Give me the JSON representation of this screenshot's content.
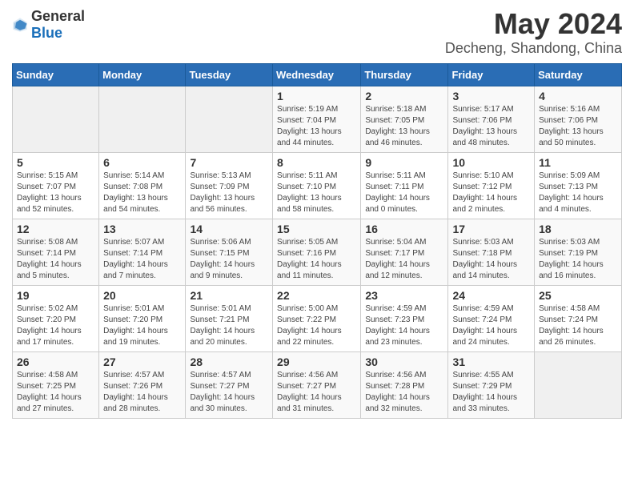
{
  "logo": {
    "general": "General",
    "blue": "Blue"
  },
  "title": "May 2024",
  "location": "Decheng, Shandong, China",
  "weekdays": [
    "Sunday",
    "Monday",
    "Tuesday",
    "Wednesday",
    "Thursday",
    "Friday",
    "Saturday"
  ],
  "weeks": [
    [
      {
        "day": "",
        "info": ""
      },
      {
        "day": "",
        "info": ""
      },
      {
        "day": "",
        "info": ""
      },
      {
        "day": "1",
        "info": "Sunrise: 5:19 AM\nSunset: 7:04 PM\nDaylight: 13 hours\nand 44 minutes."
      },
      {
        "day": "2",
        "info": "Sunrise: 5:18 AM\nSunset: 7:05 PM\nDaylight: 13 hours\nand 46 minutes."
      },
      {
        "day": "3",
        "info": "Sunrise: 5:17 AM\nSunset: 7:06 PM\nDaylight: 13 hours\nand 48 minutes."
      },
      {
        "day": "4",
        "info": "Sunrise: 5:16 AM\nSunset: 7:06 PM\nDaylight: 13 hours\nand 50 minutes."
      }
    ],
    [
      {
        "day": "5",
        "info": "Sunrise: 5:15 AM\nSunset: 7:07 PM\nDaylight: 13 hours\nand 52 minutes."
      },
      {
        "day": "6",
        "info": "Sunrise: 5:14 AM\nSunset: 7:08 PM\nDaylight: 13 hours\nand 54 minutes."
      },
      {
        "day": "7",
        "info": "Sunrise: 5:13 AM\nSunset: 7:09 PM\nDaylight: 13 hours\nand 56 minutes."
      },
      {
        "day": "8",
        "info": "Sunrise: 5:11 AM\nSunset: 7:10 PM\nDaylight: 13 hours\nand 58 minutes."
      },
      {
        "day": "9",
        "info": "Sunrise: 5:11 AM\nSunset: 7:11 PM\nDaylight: 14 hours\nand 0 minutes."
      },
      {
        "day": "10",
        "info": "Sunrise: 5:10 AM\nSunset: 7:12 PM\nDaylight: 14 hours\nand 2 minutes."
      },
      {
        "day": "11",
        "info": "Sunrise: 5:09 AM\nSunset: 7:13 PM\nDaylight: 14 hours\nand 4 minutes."
      }
    ],
    [
      {
        "day": "12",
        "info": "Sunrise: 5:08 AM\nSunset: 7:14 PM\nDaylight: 14 hours\nand 5 minutes."
      },
      {
        "day": "13",
        "info": "Sunrise: 5:07 AM\nSunset: 7:14 PM\nDaylight: 14 hours\nand 7 minutes."
      },
      {
        "day": "14",
        "info": "Sunrise: 5:06 AM\nSunset: 7:15 PM\nDaylight: 14 hours\nand 9 minutes."
      },
      {
        "day": "15",
        "info": "Sunrise: 5:05 AM\nSunset: 7:16 PM\nDaylight: 14 hours\nand 11 minutes."
      },
      {
        "day": "16",
        "info": "Sunrise: 5:04 AM\nSunset: 7:17 PM\nDaylight: 14 hours\nand 12 minutes."
      },
      {
        "day": "17",
        "info": "Sunrise: 5:03 AM\nSunset: 7:18 PM\nDaylight: 14 hours\nand 14 minutes."
      },
      {
        "day": "18",
        "info": "Sunrise: 5:03 AM\nSunset: 7:19 PM\nDaylight: 14 hours\nand 16 minutes."
      }
    ],
    [
      {
        "day": "19",
        "info": "Sunrise: 5:02 AM\nSunset: 7:20 PM\nDaylight: 14 hours\nand 17 minutes."
      },
      {
        "day": "20",
        "info": "Sunrise: 5:01 AM\nSunset: 7:20 PM\nDaylight: 14 hours\nand 19 minutes."
      },
      {
        "day": "21",
        "info": "Sunrise: 5:01 AM\nSunset: 7:21 PM\nDaylight: 14 hours\nand 20 minutes."
      },
      {
        "day": "22",
        "info": "Sunrise: 5:00 AM\nSunset: 7:22 PM\nDaylight: 14 hours\nand 22 minutes."
      },
      {
        "day": "23",
        "info": "Sunrise: 4:59 AM\nSunset: 7:23 PM\nDaylight: 14 hours\nand 23 minutes."
      },
      {
        "day": "24",
        "info": "Sunrise: 4:59 AM\nSunset: 7:24 PM\nDaylight: 14 hours\nand 24 minutes."
      },
      {
        "day": "25",
        "info": "Sunrise: 4:58 AM\nSunset: 7:24 PM\nDaylight: 14 hours\nand 26 minutes."
      }
    ],
    [
      {
        "day": "26",
        "info": "Sunrise: 4:58 AM\nSunset: 7:25 PM\nDaylight: 14 hours\nand 27 minutes."
      },
      {
        "day": "27",
        "info": "Sunrise: 4:57 AM\nSunset: 7:26 PM\nDaylight: 14 hours\nand 28 minutes."
      },
      {
        "day": "28",
        "info": "Sunrise: 4:57 AM\nSunset: 7:27 PM\nDaylight: 14 hours\nand 30 minutes."
      },
      {
        "day": "29",
        "info": "Sunrise: 4:56 AM\nSunset: 7:27 PM\nDaylight: 14 hours\nand 31 minutes."
      },
      {
        "day": "30",
        "info": "Sunrise: 4:56 AM\nSunset: 7:28 PM\nDaylight: 14 hours\nand 32 minutes."
      },
      {
        "day": "31",
        "info": "Sunrise: 4:55 AM\nSunset: 7:29 PM\nDaylight: 14 hours\nand 33 minutes."
      },
      {
        "day": "",
        "info": ""
      }
    ]
  ]
}
